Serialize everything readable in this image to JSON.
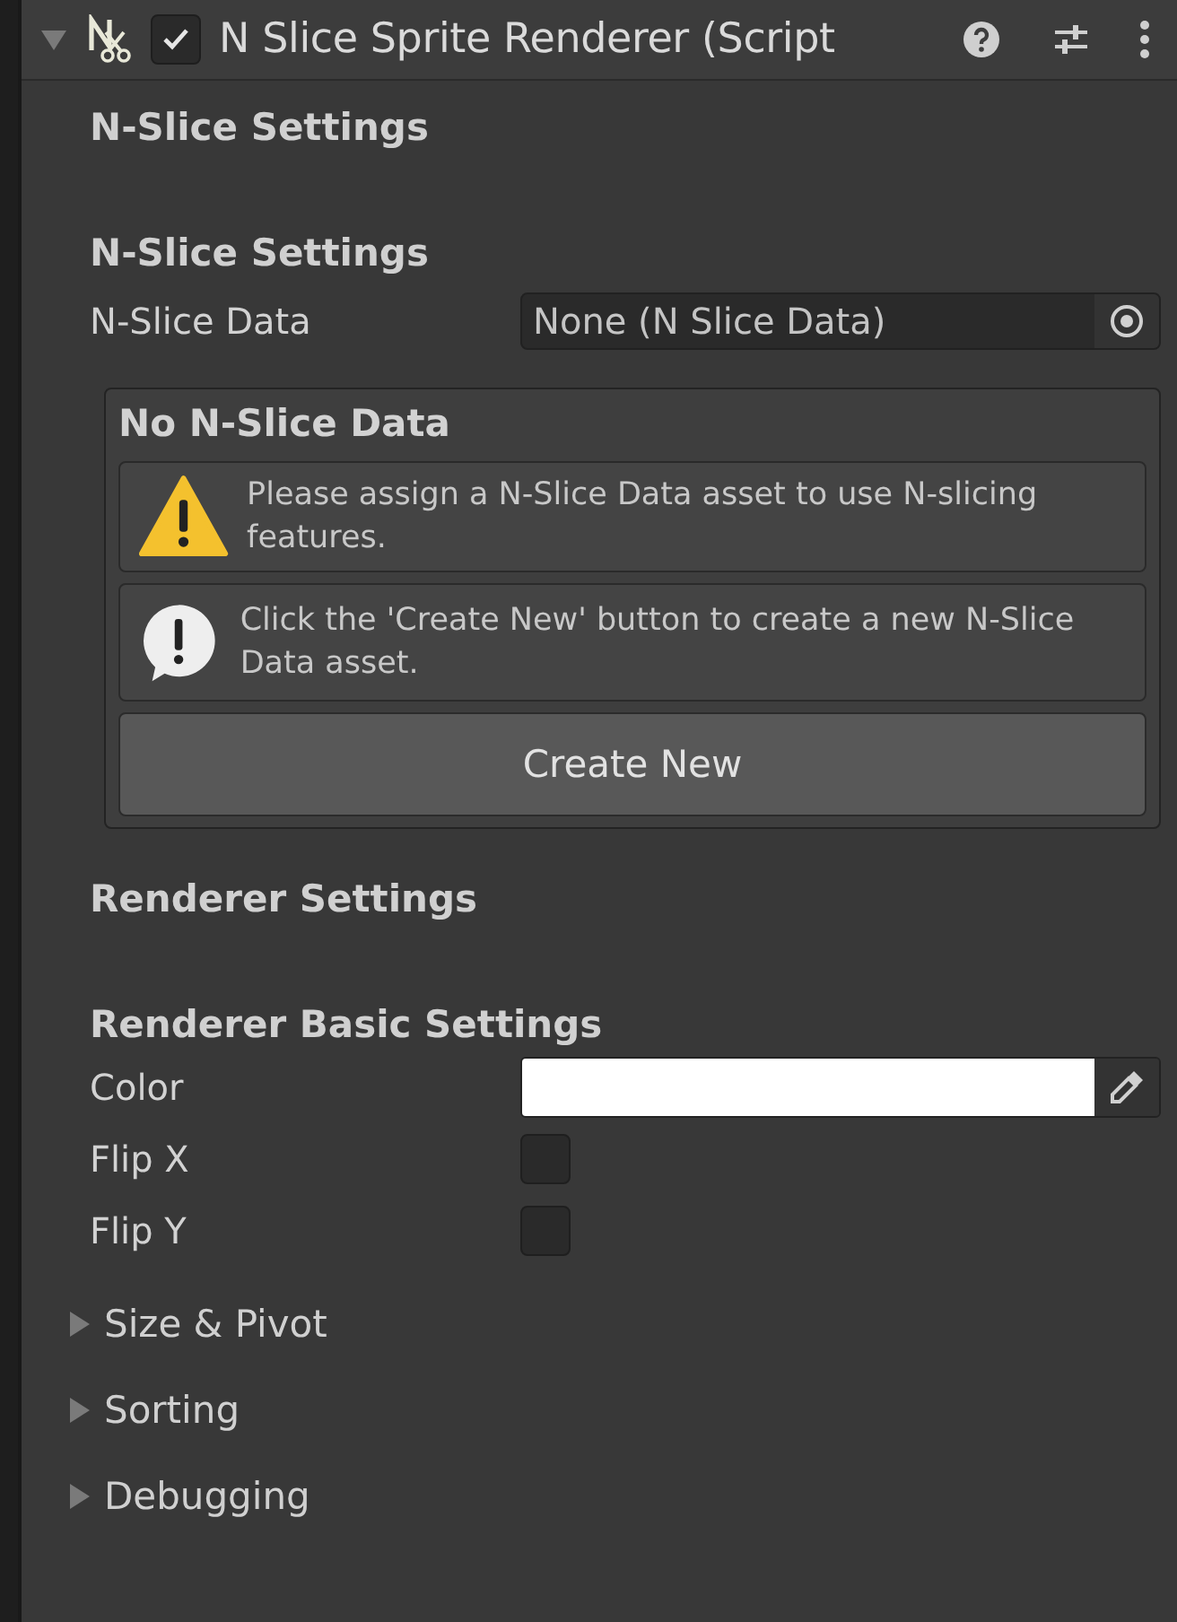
{
  "component": {
    "title": "N Slice Sprite Renderer (Script",
    "expanded": true,
    "enabled": true
  },
  "content": [
    {
      "kind": "header",
      "text": "N-Slice Settings"
    },
    {
      "kind": "header",
      "text": "N-Slice Settings"
    },
    {
      "kind": "object",
      "label": "N-Slice Data",
      "value": "None (N Slice Data)"
    },
    {
      "kind": "group",
      "title": "No N-Slice Data",
      "messages": [
        {
          "kind": "warning",
          "text": "Please assign a N-Slice Data asset to use N-slicing features."
        },
        {
          "kind": "info",
          "text": "Click the 'Create New' button to create a new N-Slice Data asset."
        }
      ],
      "button": "Create New"
    },
    {
      "kind": "header",
      "text": "Renderer Settings"
    },
    {
      "kind": "header",
      "text": "Renderer Basic Settings"
    },
    {
      "kind": "color",
      "label": "Color",
      "color": "#ffffff"
    },
    {
      "kind": "toggle",
      "label": "Flip X",
      "checked": false
    },
    {
      "kind": "toggle",
      "label": "Flip Y",
      "checked": false
    },
    {
      "kind": "foldout",
      "label": "Size & Pivot",
      "expanded": false
    },
    {
      "kind": "foldout",
      "label": "Sorting",
      "expanded": false
    },
    {
      "kind": "foldout",
      "label": "Debugging",
      "expanded": false
    }
  ]
}
